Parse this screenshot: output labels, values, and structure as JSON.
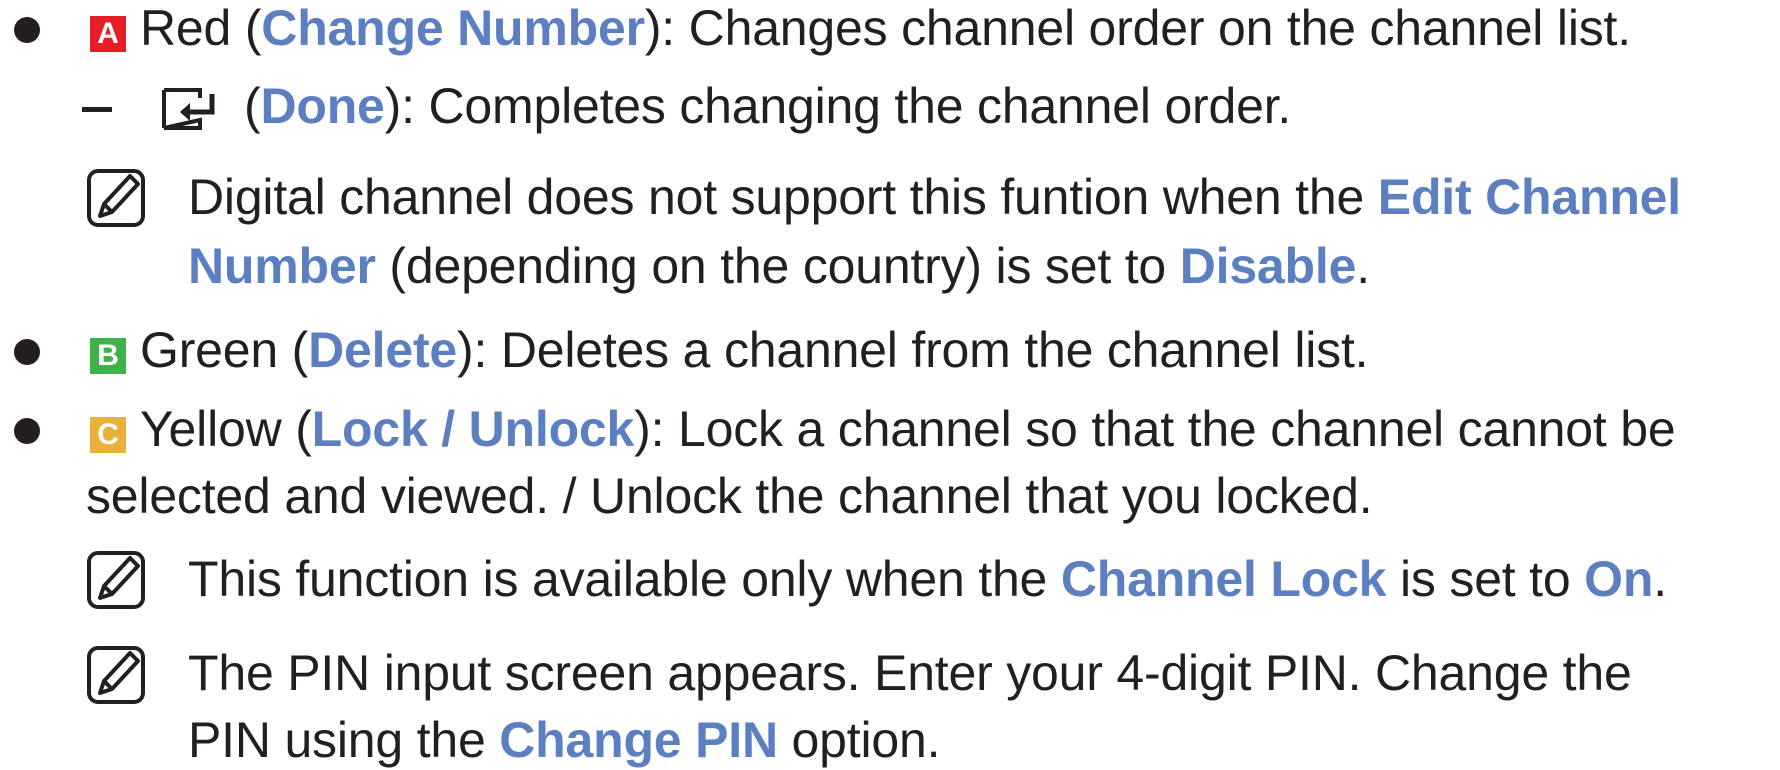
{
  "items": {
    "red": {
      "key_letter": "A",
      "color_name": "Red",
      "open_paren": " (",
      "action": "Change Number",
      "description": "): Changes channel order on the channel list.",
      "sub": {
        "open_paren": "(",
        "action": "Done",
        "description": "): Completes changing the channel order."
      },
      "note": {
        "line1_text": "Digital channel does not support this funtion when the ",
        "line1_hl": "Edit Channel",
        "line2_hl": "Number",
        "line2_text": " (depending on the country) is set to ",
        "line2_hl2": "Disable",
        "line2_end": "."
      }
    },
    "green": {
      "key_letter": "B",
      "color_name": "Green",
      "open_paren": " (",
      "action": "Delete",
      "description": "): Deletes a channel from the channel list."
    },
    "yellow": {
      "key_letter": "C",
      "color_name": "Yellow",
      "open_paren": " (",
      "action": "Lock / Unlock",
      "description": "): Lock a channel so that the channel cannot be",
      "line2": "selected and viewed. / Unlock the channel that you locked.",
      "note1": {
        "text1": "This function is available only when the ",
        "hl1": "Channel Lock",
        "text2": " is set to ",
        "hl2": "On",
        "end": "."
      },
      "note2": {
        "line1": "The PIN input screen appears. Enter your 4-digit PIN. Change the",
        "line2_text": "PIN using the ",
        "line2_hl": "Change PIN",
        "line2_end": " option."
      }
    }
  },
  "colors": {
    "text": "#231f20",
    "highlight": "#5b7fc1",
    "key_red": "#e61e25",
    "key_green": "#3fb34a",
    "key_yellow": "#e9b13a"
  },
  "icons": {
    "note": "note-pencil-icon",
    "enter": "enter-key-icon"
  }
}
